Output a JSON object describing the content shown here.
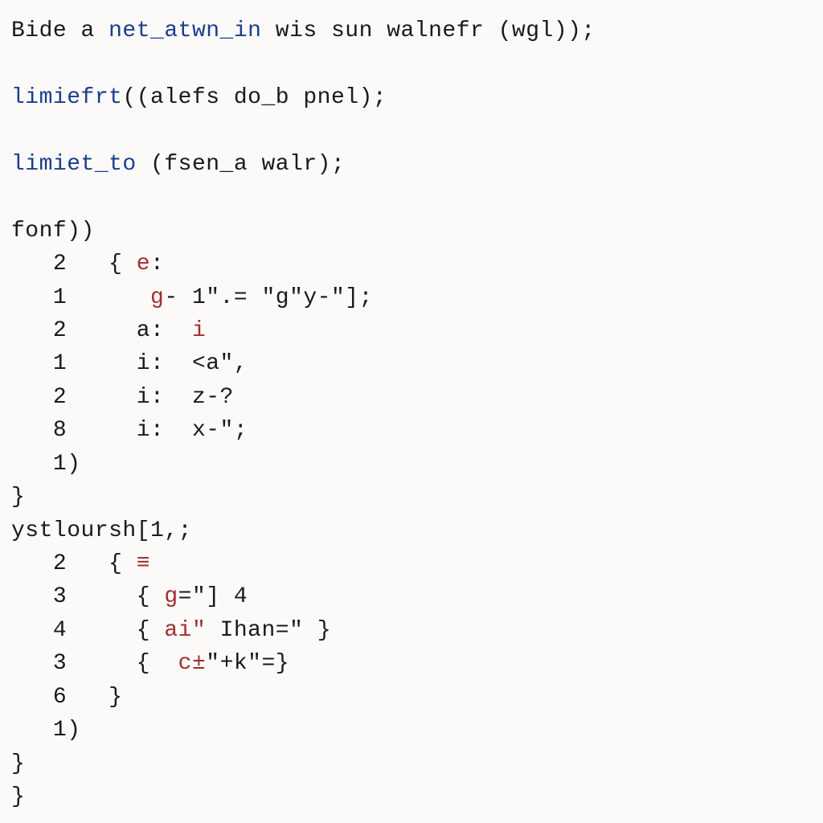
{
  "colors": {
    "keyword": "#1a3d8f",
    "accent": "#a03030",
    "text": "#1a1a1a",
    "background": "#fbfaf8"
  },
  "code": {
    "l1": {
      "pre": "Bide a ",
      "kw": "net_atwn_in",
      "rest": " wis sun walnefr (wgl));"
    },
    "l2": {
      "kw": "limiefrt",
      "rest": "((alefs do_b pnel);"
    },
    "l3": {
      "kw": "limiet_to",
      "rest": " (fsen_a walr);"
    },
    "l4": "fonf))",
    "l5": {
      "gutter": "   2   ",
      "body": "{ ",
      "red": "e",
      "body2": ":"
    },
    "l6": {
      "gutter": "   1      ",
      "red": "g",
      "body": "- 1\".= \"g\"y-\"];"
    },
    "l7": {
      "gutter": "   2     ",
      "body": "a:  ",
      "red": "i"
    },
    "l8": {
      "gutter": "   1     ",
      "body": "i:  <a\","
    },
    "l9": {
      "gutter": "   2     ",
      "body": "i:  z-?"
    },
    "l10": {
      "gutter": "   8     ",
      "body": "i:  x-\";"
    },
    "l11": "   1)",
    "l12": "}",
    "l13": "ystloursh[1,;",
    "l14": {
      "gutter": "   2   ",
      "body": "{ ",
      "red": "≡"
    },
    "l15": {
      "gutter": "   3     ",
      "body": "{ ",
      "red": "g",
      "body2": "=\"] 4"
    },
    "l16": {
      "gutter": "   4     ",
      "body": "{ ",
      "red": "ai\"",
      "body2": " Ihan=\" }"
    },
    "l17": {
      "gutter": "   3     ",
      "body": "{  ",
      "red": "c±",
      "body2": "\"+k\"=}"
    },
    "l18": "   6   }",
    "l19": "   1)",
    "l20": "}",
    "l21": "}"
  }
}
